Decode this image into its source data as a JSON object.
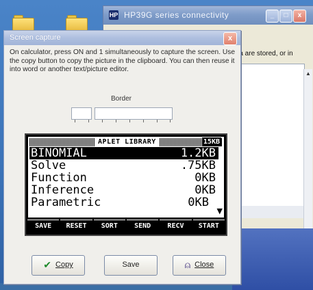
{
  "background_window": {
    "title": "HP39G series connectivity",
    "app_icon": "HP",
    "info_text": "ata are stored, or in",
    "controls": {
      "minimize": "_",
      "maximize": "□",
      "close": "x"
    }
  },
  "dialog": {
    "title": "Screen capture",
    "close_glyph": "x",
    "instructions": "On calculator, press ON and 1 simultaneously to capture the screen. Use the copy button to copy the picture in the clipboard. You can then reuse it into word or another text/picture editor.",
    "border_label": "Border",
    "buttons": {
      "copy": "Copy",
      "save": "Save",
      "close": "Close"
    }
  },
  "calculator_screen": {
    "header_title": "APLET LIBRARY",
    "header_size": "15KB",
    "items": [
      {
        "name": "BINOMIAL",
        "size": "1.2KB",
        "selected": true
      },
      {
        "name": "Solve",
        "size": ".75KB",
        "selected": false
      },
      {
        "name": "Function",
        "size": "0KB",
        "selected": false
      },
      {
        "name": "Inference",
        "size": "0KB",
        "selected": false
      },
      {
        "name": "Parametric",
        "size": "0KB",
        "selected": false
      }
    ],
    "more_arrow": "▼",
    "menu_keys": [
      "SAVE",
      "RESET",
      "SORT",
      "SEND",
      "RECV",
      "START"
    ]
  },
  "colors": {
    "desktop": "#3a6ea5",
    "dialog_bg": "#f0efeb",
    "lcd_bg": "#000000"
  }
}
